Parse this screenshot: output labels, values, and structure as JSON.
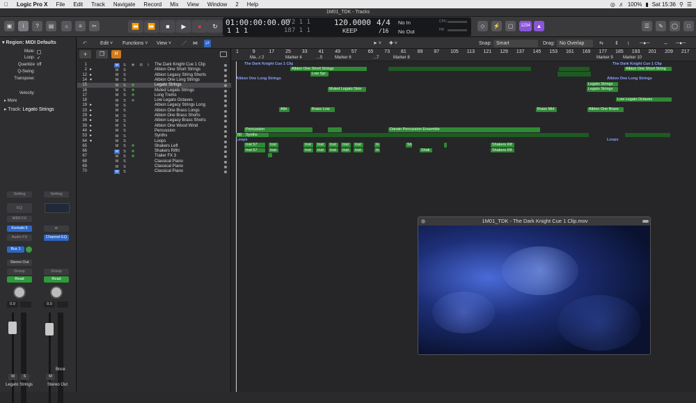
{
  "menubar": {
    "app_name": "Logic Pro X",
    "items": [
      "File",
      "Edit",
      "Track",
      "Navigate",
      "Record",
      "Mix",
      "View",
      "Window",
      "2",
      "Help"
    ],
    "battery": "100%",
    "clock": "Sat 15:36"
  },
  "window": {
    "title": "1M01_TDK - Tracks"
  },
  "lcd": {
    "time": "01:00:00:00.00",
    "bars_top": "172  1  1",
    "bars_bottom": "187  1  1",
    "pos_top": "1  1  1",
    "pos_bottom": "1  1  1",
    "tempo": "120.0000",
    "tempo_mode": "KEEP",
    "signature_top": "4/4",
    "signature_bottom": "/16",
    "in_label": "No In",
    "out_label": "No Out",
    "cpu_label": "CPU",
    "hd_label": "HD",
    "count_display": "1234"
  },
  "inspector": {
    "region_header": "Region: MIDI Defaults",
    "mute_label": "Mute:",
    "loop_label": "Loop:",
    "quantize_label": "Quantize",
    "quantize_value": "off",
    "qswing_label": "Q-Swing:",
    "transpose_label": "Transpose:",
    "velocity_label": "Velocity:",
    "more_label": "More",
    "track_header": "Track:",
    "track_name": "Legato Strings",
    "strip_left": {
      "setting": "Setting",
      "eq": "EQ",
      "midi_fx": "MIDI FX",
      "instrument": "Kontakt 5",
      "audio_fx": "Audio FX",
      "send": "Bus 1",
      "output": "Stereo Out",
      "group": "Group",
      "automation": "Read",
      "volume": "0.0",
      "mute": "M",
      "solo": "S",
      "name": "Legato Strings"
    },
    "strip_right": {
      "setting": "Setting",
      "eq_plugin": "Channel EQ",
      "group": "Group",
      "automation": "Read",
      "volume": "0.0",
      "mute": "M",
      "bounce": "Bnce",
      "name": "Stereo Out"
    }
  },
  "tracks_header": {
    "edit": "Edit",
    "functions": "Functions",
    "view": "View",
    "snap_label": "Snap:",
    "snap_value": "Smart",
    "drag_label": "Drag:",
    "drag_value": "No Overlap"
  },
  "ruler": {
    "numbers": [
      "1",
      "9",
      "17",
      "25",
      "33",
      "41",
      "49",
      "57",
      "65",
      "73",
      "81",
      "89",
      "97",
      "105",
      "113",
      "121",
      "129",
      "137",
      "145",
      "153",
      "161",
      "169",
      "177",
      "185",
      "193",
      "201",
      "209",
      "217"
    ],
    "markers": [
      "Ma...r 2",
      "Marker 4",
      "...5",
      "Marker 6",
      "...7",
      "Marker 8",
      "Marker 9",
      "Marker 10"
    ]
  },
  "tracks": [
    {
      "num": "1",
      "name": "The Dark Knight Cue 1 Clip"
    },
    {
      "num": "2",
      "name": "Albion One Short Strings"
    },
    {
      "num": "12",
      "name": "Albion Legacy String Shorts"
    },
    {
      "num": "14",
      "name": "Albion One Long Strings"
    },
    {
      "num": "15",
      "name": "Legato Strings"
    },
    {
      "num": "16",
      "name": "Muted Legato Strings"
    },
    {
      "num": "17",
      "name": "Long Trems"
    },
    {
      "num": "18",
      "name": "Low Legato Octaves"
    },
    {
      "num": "19",
      "name": "Albion Legacy Strings Long"
    },
    {
      "num": "23",
      "name": "Albion One Brass Longs"
    },
    {
      "num": "29",
      "name": "Albion One Brass Shorts"
    },
    {
      "num": "34",
      "name": "Albion Legacy Brass Shorts"
    },
    {
      "num": "39",
      "name": "Albion One Wood Wind"
    },
    {
      "num": "44",
      "name": "Percussion"
    },
    {
      "num": "53",
      "name": "Synths"
    },
    {
      "num": "64",
      "name": "Loops"
    },
    {
      "num": "65",
      "name": "Shakers Left"
    },
    {
      "num": "66",
      "name": "Shakers Rifht"
    },
    {
      "num": "67",
      "name": "Trailer FX 3"
    },
    {
      "num": "68",
      "name": "Classical Piano"
    },
    {
      "num": "69",
      "name": "Classical Piano"
    },
    {
      "num": "70",
      "name": "Classical Piano"
    }
  ],
  "regions": {
    "clip1": "The Dark Knight Cue 1 Clip",
    "clip2": "The Dark Knight Cue 1 Clip",
    "short_strings1": "Albion One Short Strings",
    "short_strings2": "Albion One Short String",
    "low_spi": "Low Spi",
    "long_strings1": "Albion One Long Strings",
    "long_strings2": "Albion One Long Strings",
    "legato1": "Legato Strings",
    "legato2": "Legato Strings",
    "muted": "Muted Legato Strin",
    "low_legato": "Low Legato Octaves",
    "albi": "Albi",
    "brass_low": "Brass Low",
    "brass_mid": "Brass Mid",
    "brass_one": "Albion One Brass",
    "percussion": "Percussion",
    "darwin": "Darwin Percussion Ensemble",
    "r60": "60",
    "synths": "Synths",
    "loops1": "Loops",
    "loops2": "Loops",
    "inst57a": "Inst 57",
    "inst57b": "Inst 57",
    "inst": "Inst",
    "in": "In",
    "sh": "Sh",
    "shak": "Shak",
    "shakers_rif": "Shakers Rif",
    "shakers_rif2": "Shakers Rif"
  },
  "movie": {
    "title": "1M01_TDK - The Dark Knight Cue 1 Clip.mov"
  },
  "colors": {
    "accent": "#2e67c4",
    "region_green": "#2f8a34",
    "loop_blue": "#8da3ff"
  }
}
